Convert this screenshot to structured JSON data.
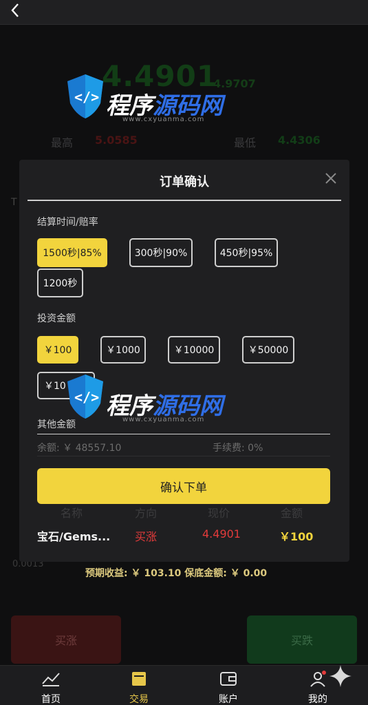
{
  "header": {
    "back_icon": "chevron-left-icon"
  },
  "ticker": {
    "price": "4.4901",
    "sub_price": "4.9707",
    "high_label": "最高",
    "high_value": "5.0585",
    "low_label": "最低",
    "low_value": "4.4306"
  },
  "background": {
    "side_letter": "T",
    "left_number": "0.0013",
    "buy_up_label": "买涨",
    "buy_down_label": "买跌"
  },
  "modal": {
    "title": "订单确认",
    "close_icon": "close-icon",
    "time_section_label": "结算时间/赔率",
    "time_options": [
      "1500秒|85%",
      "300秒|90%",
      "450秒|95%",
      "1200秒"
    ],
    "time_selected_index": 0,
    "amount_section_label": "投资金额",
    "amount_options": [
      "￥100",
      "￥1000",
      "￥10000",
      "￥50000",
      "￥10"
    ],
    "amount_selected_index": 0,
    "other_amount_label": "其他金额",
    "balance_text": "余额: ￥ 48557.10",
    "fee_text": "手续费: 0%",
    "confirm_label": "确认下单",
    "columns": [
      "名称",
      "方向",
      "现价",
      "金额"
    ],
    "order": {
      "name": "宝石/Gems...",
      "direction": "买涨",
      "price": "4.4901",
      "amount": "￥100"
    },
    "expected_text": "预期收益: ￥ 103.10   保底金额: ￥ 0.00"
  },
  "nav": {
    "items": [
      {
        "label": "首页",
        "icon": "chart-icon"
      },
      {
        "label": "交易",
        "icon": "trade-icon",
        "active": true
      },
      {
        "label": "账户",
        "icon": "wallet-icon"
      },
      {
        "label": "我的",
        "icon": "user-icon"
      }
    ]
  },
  "watermark": {
    "text": "程序源码网",
    "url": "www.cxyuanma.com"
  },
  "colors": {
    "accent": "#f2d43d",
    "up": "#e23b3b",
    "down": "#2ea043",
    "modal_bg": "#1f1f21"
  }
}
